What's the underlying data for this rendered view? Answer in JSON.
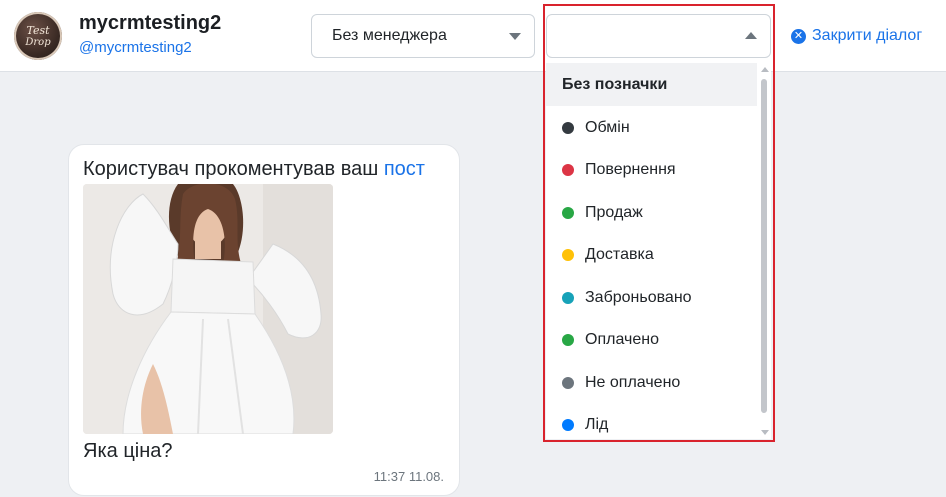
{
  "header": {
    "user_name": "mycrmtesting2",
    "user_handle": "@mycrmtesting2",
    "avatar_text_line1": "Test",
    "avatar_text_line2": "Drop",
    "manager_select_value": "Без менеджера",
    "label_select_value": "",
    "close_dialog_label": "Закрити діалог"
  },
  "label_dropdown": {
    "options": [
      {
        "label": "Без позначки",
        "color": null
      },
      {
        "label": "Обмін",
        "color": "#343a40"
      },
      {
        "label": "Повернення",
        "color": "#dc3545"
      },
      {
        "label": "Продаж",
        "color": "#28a745"
      },
      {
        "label": "Доставка",
        "color": "#ffc107"
      },
      {
        "label": "Заброньовано",
        "color": "#17a2b8"
      },
      {
        "label": "Оплачено",
        "color": "#28a745"
      },
      {
        "label": "Не оплачено",
        "color": "#6c757d"
      },
      {
        "label": "Лід",
        "color": "#007bff"
      }
    ]
  },
  "message": {
    "title_text": "Користувач прокоментував ваш ",
    "title_link": "пост",
    "comment_text": "Яка ціна?",
    "time": "11:37 11.08."
  },
  "colors": {
    "accent": "#1a73e8",
    "highlight": "#d9232d"
  }
}
